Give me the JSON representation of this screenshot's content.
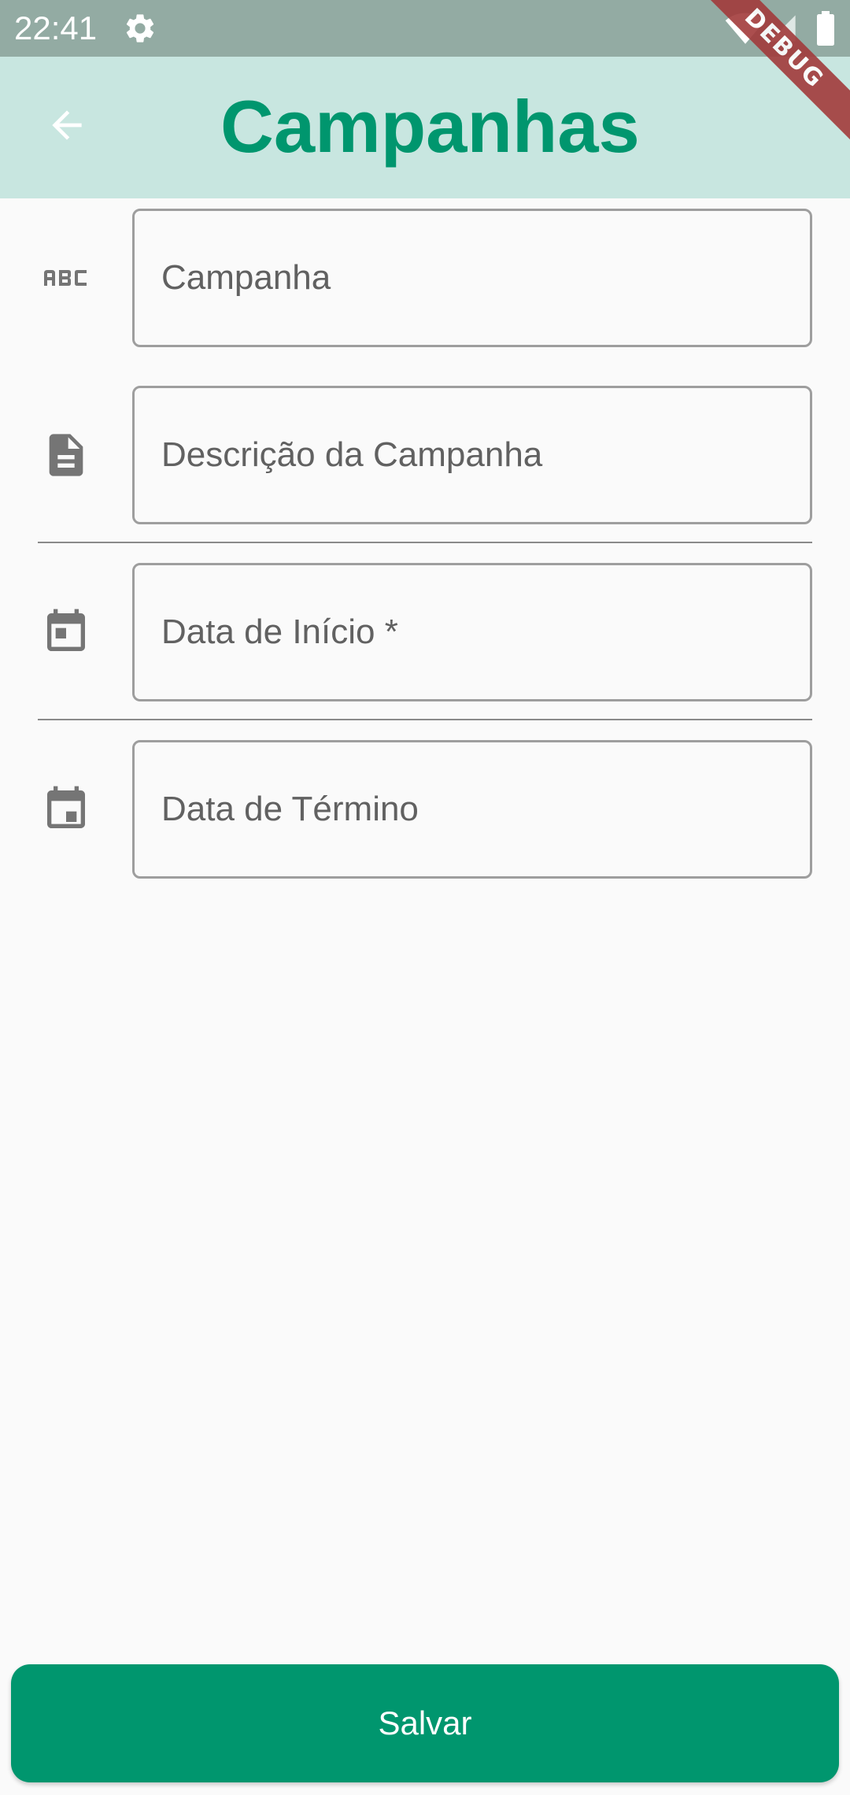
{
  "status_bar": {
    "time": "22:41",
    "icons": [
      "gear-icon",
      "wifi-icon",
      "signal-icon",
      "battery-icon"
    ]
  },
  "debug_banner": "DEBUG",
  "app_bar": {
    "title": "Campanhas",
    "back_icon": "arrow-back-icon",
    "background_color": "#c8e6e0",
    "title_color": "#00966e"
  },
  "form": {
    "fields": [
      {
        "icon": "abc-icon",
        "placeholder": "Campanha",
        "value": ""
      },
      {
        "icon": "document-icon",
        "placeholder": "Descrição da Campanha",
        "value": ""
      },
      {
        "icon": "calendar-start-icon",
        "placeholder": "Data de Início *",
        "value": ""
      },
      {
        "icon": "calendar-end-icon",
        "placeholder": "Data de Término",
        "value": ""
      }
    ]
  },
  "save_button": {
    "label": "Salvar",
    "color": "#00966e"
  }
}
